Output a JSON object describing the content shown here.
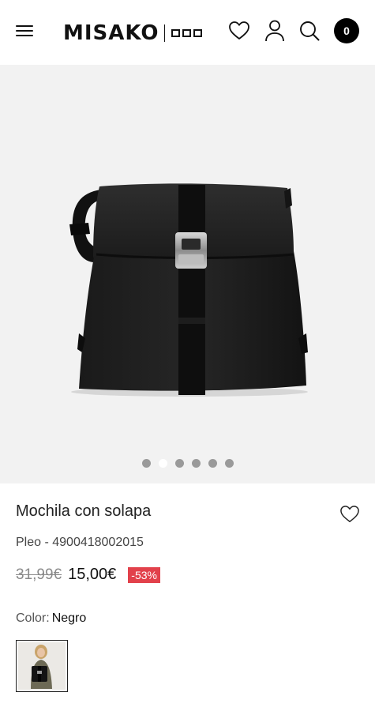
{
  "header": {
    "brand": "MISAKO",
    "cart_count": "0"
  },
  "icons": {
    "menu": "menu-icon",
    "wishlist": "heart-icon",
    "account": "user-icon",
    "search": "search-icon"
  },
  "gallery": {
    "image": "black backpack with flap and buckle",
    "slides": 6,
    "active_slide": 2
  },
  "product": {
    "name": "Mochila con solapa",
    "reference": "Pleo - 4900418002015",
    "old_price": "31,99€",
    "price": "15,00€",
    "discount": "-53%",
    "color_label": "Color:",
    "color_value": "Negro"
  },
  "colors": {
    "discount_bg": "#e2414b",
    "gallery_bg": "#f2f2f2"
  }
}
